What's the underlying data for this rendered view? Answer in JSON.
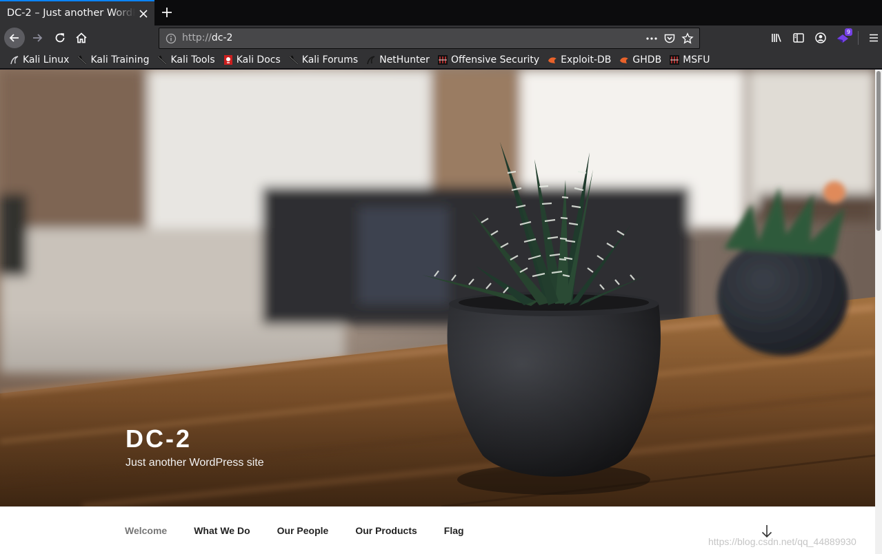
{
  "browser": {
    "tab": {
      "title": "DC-2 – Just another WordPress site"
    },
    "url": {
      "protocol": "http://",
      "host": "dc-2"
    },
    "addon_badge": "9"
  },
  "bookmarks": [
    {
      "label": "Kali Linux",
      "icon": "kali-dragon-icon"
    },
    {
      "label": "Kali Training",
      "icon": "kali-dragon-icon"
    },
    {
      "label": "Kali Tools",
      "icon": "kali-dragon-icon"
    },
    {
      "label": "Kali Docs",
      "icon": "kali-docs-icon"
    },
    {
      "label": "Kali Forums",
      "icon": "kali-dragon-icon"
    },
    {
      "label": "NetHunter",
      "icon": "nethunter-icon"
    },
    {
      "label": "Offensive Security",
      "icon": "offsec-icon"
    },
    {
      "label": "Exploit-DB",
      "icon": "exploitdb-icon"
    },
    {
      "label": "GHDB",
      "icon": "exploitdb-icon"
    },
    {
      "label": "MSFU",
      "icon": "offsec-icon"
    }
  ],
  "site": {
    "title": "DC-2",
    "description": "Just another WordPress site"
  },
  "menu": [
    {
      "label": "Welcome",
      "current": true
    },
    {
      "label": "What We Do"
    },
    {
      "label": "Our People"
    },
    {
      "label": "Our Products"
    },
    {
      "label": "Flag"
    }
  ],
  "watermark": "https://blog.csdn.net/qq_44889930",
  "colors": {
    "accent": "#0a84ff",
    "toolbar": "#323234",
    "tabstrip": "#0c0c0d"
  }
}
